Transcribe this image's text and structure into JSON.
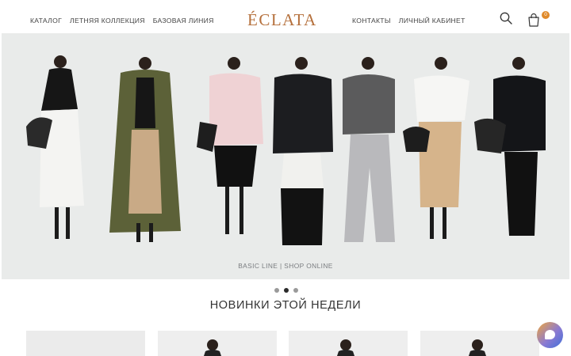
{
  "header": {
    "nav_left": [
      "КАТАЛОГ",
      "ЛЕТНЯЯ КОЛЛЕКЦИЯ",
      "БАЗОВАЯ ЛИНИЯ"
    ],
    "logo": "ÉCLATA",
    "nav_right": [
      "КОНТАКТЫ",
      "ЛИЧНЫЙ КАБИНЕТ"
    ],
    "cart_count": "0",
    "icons": [
      "search-icon",
      "shopping-bag-icon"
    ]
  },
  "hero": {
    "caption": "BASIC LINE | SHOP ONLINE",
    "slide_count": 3,
    "active_slide": 2
  },
  "section": {
    "title": "НОВИНКИ ЭТОЙ НЕДЕЛИ"
  },
  "colors": {
    "logo": "#b5703c",
    "badge": "#e08a2a",
    "hero_bg": "#e9ebea"
  }
}
